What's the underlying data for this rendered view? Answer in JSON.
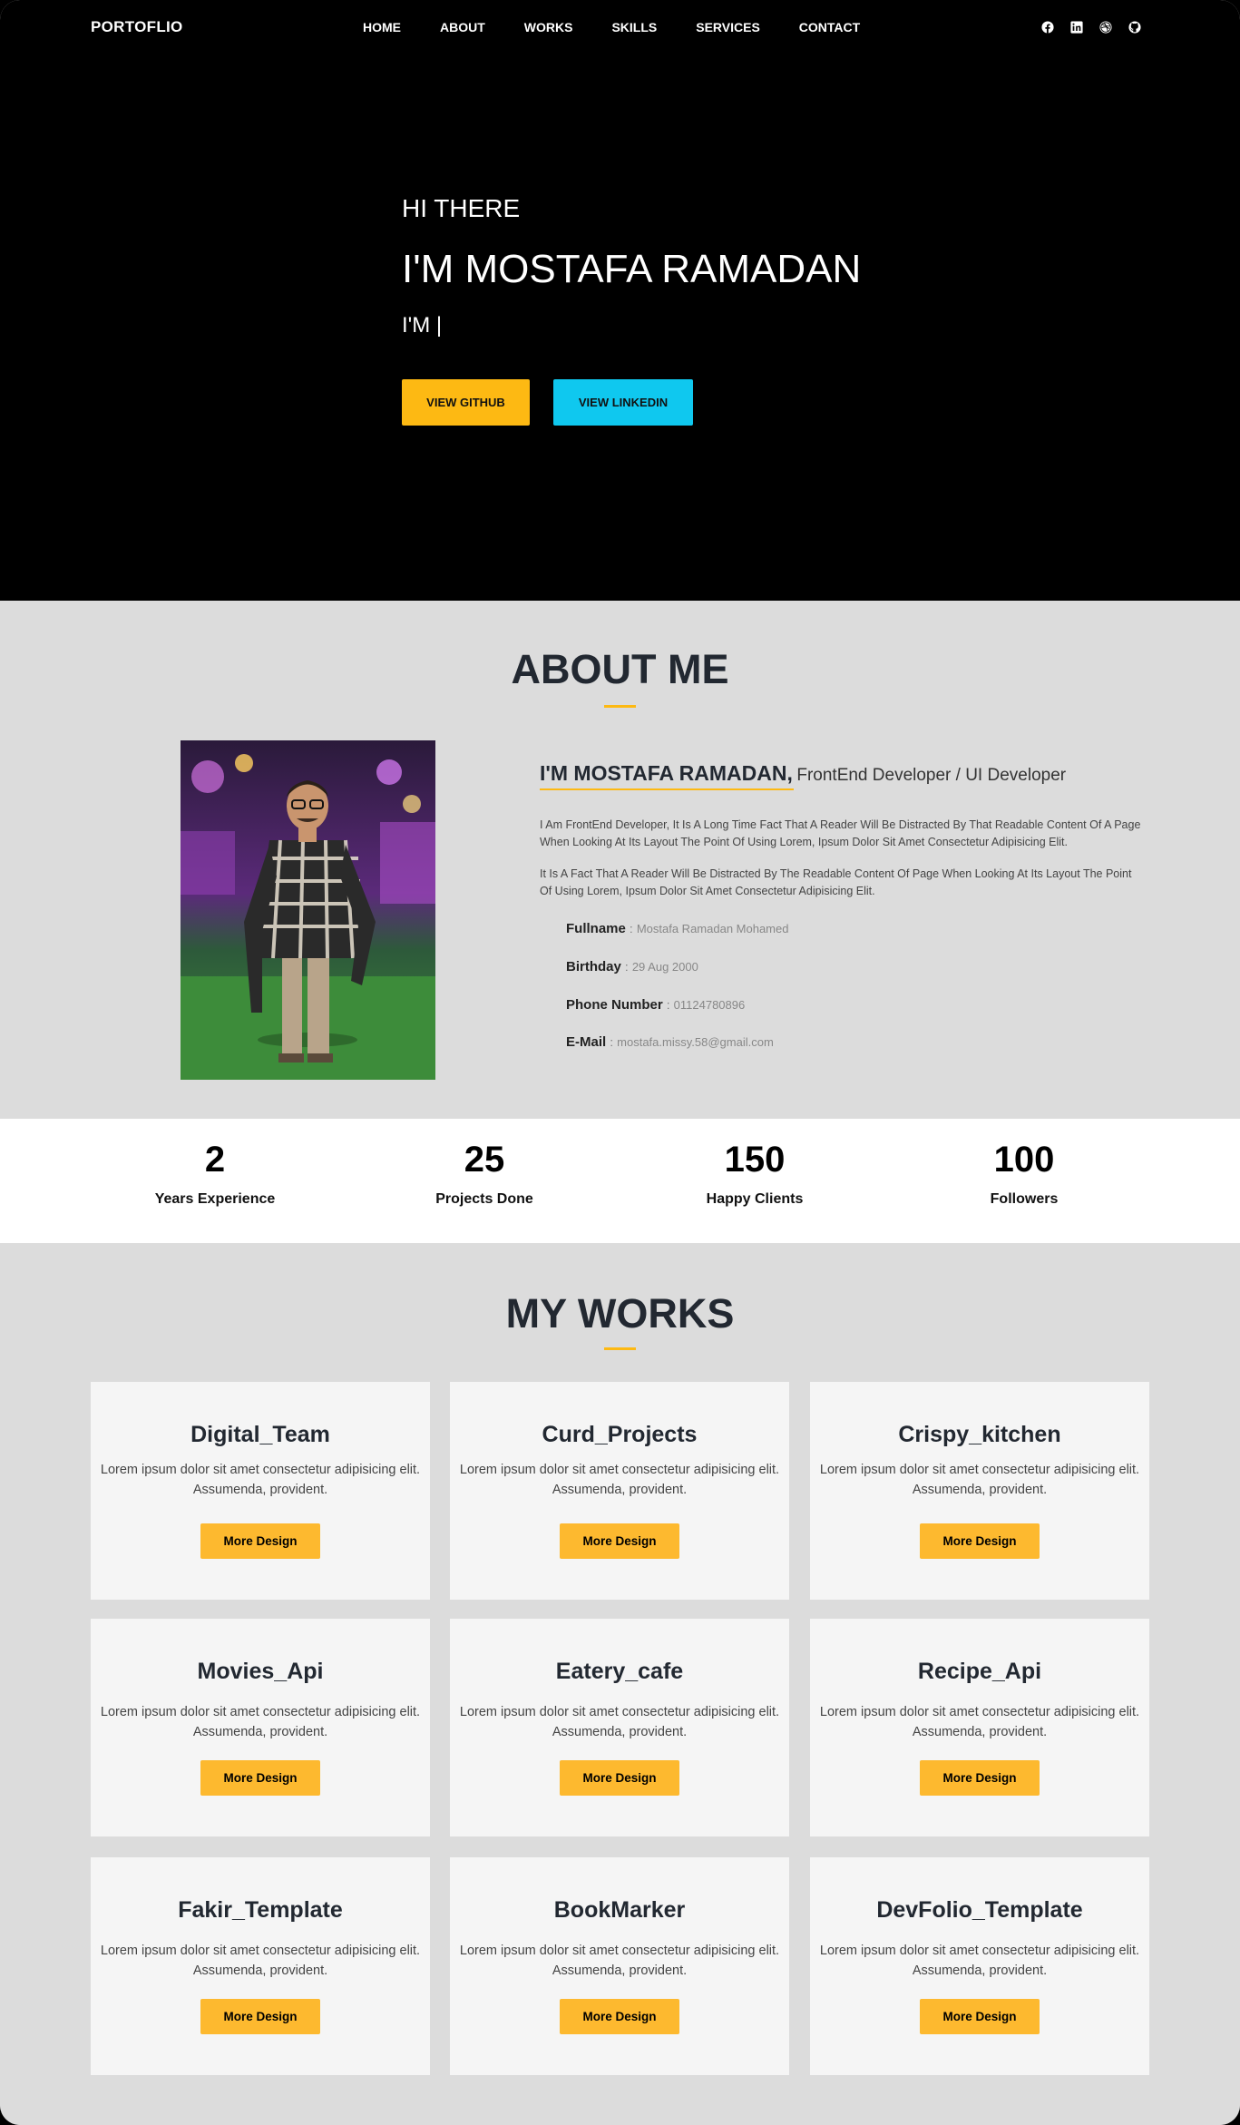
{
  "nav": {
    "brand": "PORTOFLIO",
    "links": [
      "HOME",
      "ABOUT",
      "WORKS",
      "SKILLS",
      "SERVICES",
      "CONTACT"
    ],
    "social_icons": [
      "facebook-icon",
      "linkedin-icon",
      "dribbble-icon",
      "github-icon"
    ]
  },
  "hero": {
    "greeting": "HI THERE",
    "name": "I'M MOSTAFA RAMADAN",
    "typed": "I'M |",
    "github_button": "VIEW GITHUB",
    "linkedin_button": "VIEW LINKEDIN"
  },
  "about": {
    "title": "ABOUT ME",
    "heading_name": "I'M MOSTAFA RAMADAN,",
    "heading_role": "FrontEnd Developer / UI Developer",
    "paragraphs": [
      "I Am FrontEnd Developer, It Is A Long Time Fact That A Reader Will Be Distracted By That Readable Content Of A Page When Looking At Its Layout The Point Of Using Lorem, Ipsum Dolor Sit Amet Consectetur Adipisicing Elit.",
      "It Is A Fact That A Reader Will Be Distracted By The Readable Content Of Page When Looking At Its Layout The Point Of Using Lorem, Ipsum Dolor Sit Amet Consectetur Adipisicing Elit."
    ],
    "info": [
      {
        "label": "Fullname",
        "value": "Mostafa Ramadan Mohamed"
      },
      {
        "label": "Birthday",
        "value": "29 Aug 2000"
      },
      {
        "label": "Phone Number",
        "value": "01124780896"
      },
      {
        "label": "E-Mail",
        "value": "mostafa.missy.58@gmail.com"
      }
    ],
    "separator": ":"
  },
  "stats": [
    {
      "number": "2",
      "label": "Years Experience"
    },
    {
      "number": "25",
      "label": "Projects Done"
    },
    {
      "number": "150",
      "label": "Happy Clients"
    },
    {
      "number": "100",
      "label": "Followers"
    }
  ],
  "works": {
    "title": "MY WORKS",
    "description": "Lorem ipsum dolor sit amet consectetur adipisicing elit. Assumenda, provident.",
    "button_label": "More Design",
    "projects": [
      "Digital_Team",
      "Curd_Projects",
      "Crispy_kitchen",
      "Movies_Api",
      "Eatery_cafe",
      "Recipe_Api",
      "Fakir_Template",
      "BookMarker",
      "DevFolio_Template"
    ]
  },
  "colors": {
    "accent": "#fdb913",
    "linkedin": "#0fc8ef",
    "dark": "#222831"
  }
}
